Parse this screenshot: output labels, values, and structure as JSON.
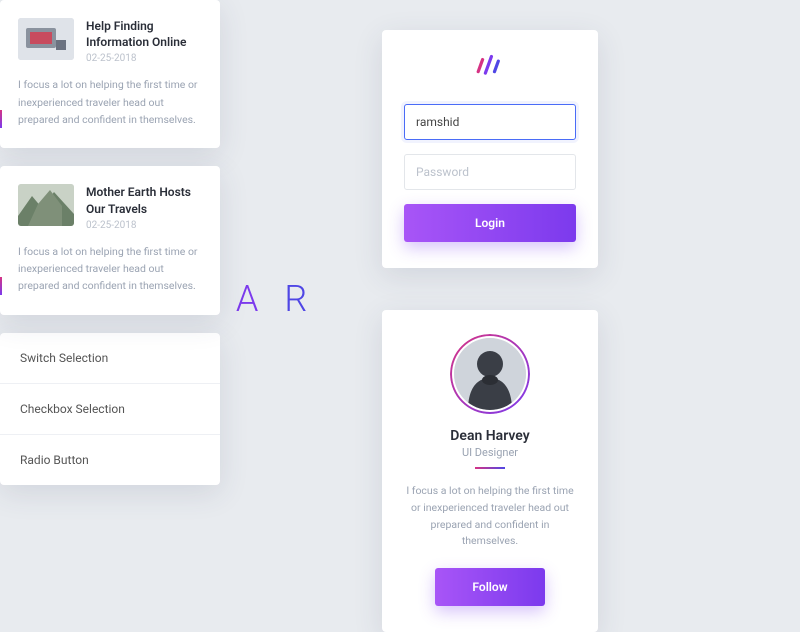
{
  "brand": "CLEAR",
  "login": {
    "username_value": "ramshid",
    "password_placeholder": "Password",
    "button": "Login"
  },
  "profile": {
    "name": "Dean Harvey",
    "role": "UI Designer",
    "bio": "I focus a lot on helping the first time or inexperienced traveler head out prepared and confident in themselves.",
    "follow": "Follow"
  },
  "feed": [
    {
      "title": "Help Finding Information Online",
      "date": "02-25-2018",
      "body": "I focus a lot on helping the first time or inexperienced traveler head out prepared and confident in themselves."
    },
    {
      "title": "Mother Earth Hosts Our Travels",
      "date": "02-25-2018",
      "body": "I focus a lot on helping the first time or inexperienced traveler head out prepared and confident in themselves."
    }
  ],
  "settings": [
    "Switch Selection",
    "Checkbox Selection",
    "Radio Button"
  ]
}
